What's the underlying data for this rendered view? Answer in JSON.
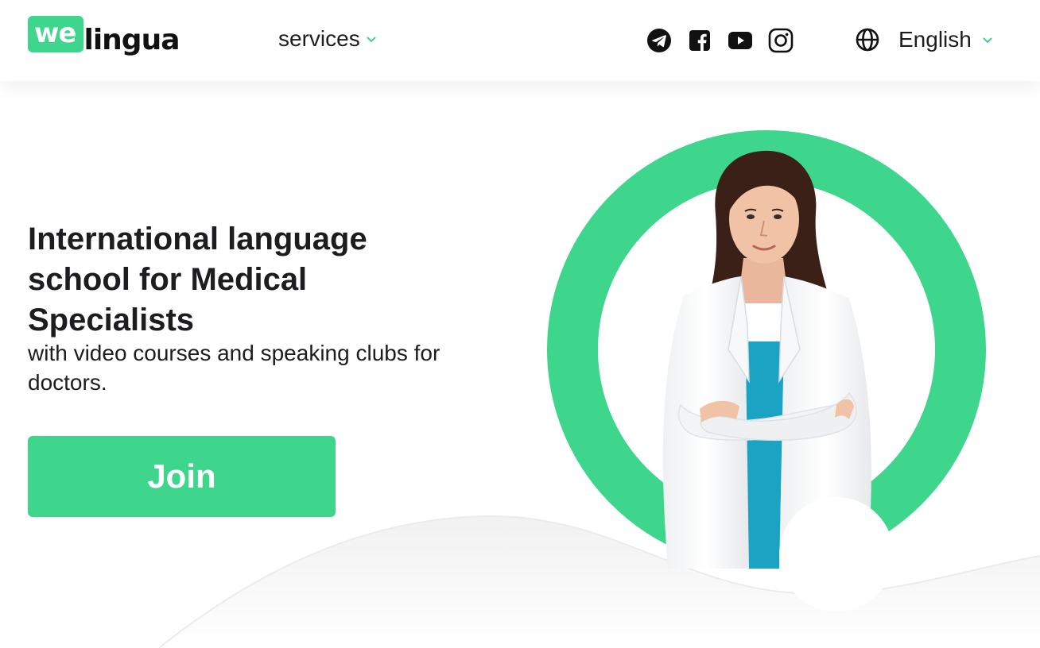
{
  "header": {
    "logo": {
      "part1": "we",
      "part2": "lingua"
    },
    "nav": {
      "services_label": "services"
    },
    "socials": [
      {
        "icon": "telegram-icon"
      },
      {
        "icon": "facebook-icon"
      },
      {
        "icon": "youtube-icon"
      },
      {
        "icon": "instagram-icon"
      }
    ],
    "language": {
      "icon": "globe-icon",
      "label": "English"
    }
  },
  "hero": {
    "title": "International language school for Medical Specialists",
    "subtitle": "with video courses and speaking clubs for doctors.",
    "cta_label": "Join",
    "image": "doctor-portrait"
  },
  "colors": {
    "accent": "#3dd68c",
    "text": "#1d1d1f",
    "background": "#ffffff"
  }
}
